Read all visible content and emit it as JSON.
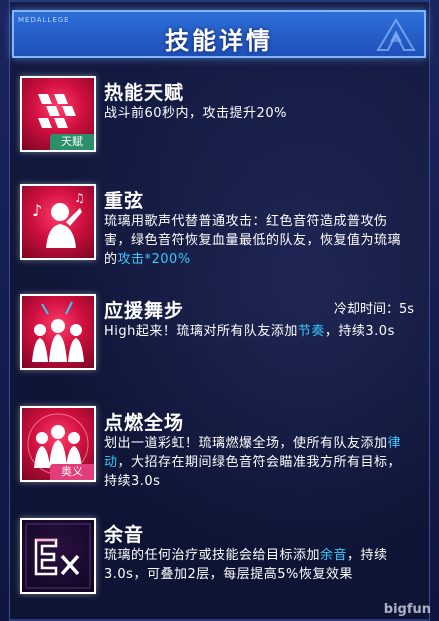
{
  "header": {
    "tag": "MEDALLEGE",
    "title": "技能详情"
  },
  "skills": [
    {
      "name": "热能天赋",
      "badge": "天赋",
      "icon": "talent-chevron-icon",
      "desc_parts": [
        {
          "text": "战斗前60秒内，攻击提升20%",
          "hl": false
        }
      ]
    },
    {
      "name": "重弦",
      "icon": "singer-note-icon",
      "desc_parts": [
        {
          "text": "琉璃用歌声代替普通攻击：红色音符造成普攻伤害，绿色音符恢复血量最低的队友，恢复值为琉璃的",
          "hl": false
        },
        {
          "text": "攻击*200%",
          "hl": true
        }
      ]
    },
    {
      "name": "应援舞步",
      "cooldown": "冷却时间：5s",
      "icon": "dancers-icon",
      "desc_parts": [
        {
          "text": "High起来！琉璃对所有队友添加",
          "hl": false
        },
        {
          "text": "节奏",
          "hl": true
        },
        {
          "text": "，持续3.0s",
          "hl": false
        }
      ]
    },
    {
      "name": "点燃全场",
      "badge": "奥义",
      "icon": "crowd-icon",
      "desc_parts": [
        {
          "text": "划出一道彩虹！琉璃燃爆全场，使所有队友添加",
          "hl": false
        },
        {
          "text": "律动",
          "hl": true
        },
        {
          "text": "，大招存在期间绿色音符会瞄准我方所有目标，持续3.0s",
          "hl": false
        }
      ]
    },
    {
      "name": "余音",
      "icon": "ex-icon",
      "desc_parts": [
        {
          "text": "琉璃的任何治疗或技能会给目标添加",
          "hl": false
        },
        {
          "text": "余音",
          "hl": true
        },
        {
          "text": "，持续3.0s，可叠加2层，每层提高5%恢复效果",
          "hl": false
        }
      ]
    }
  ],
  "watermark": "bigfun",
  "colors": {
    "header_bg": "#2d6fd8",
    "highlight": "#39c7ff",
    "icon_red": "#d0103f",
    "badge_green": "#2a8f6a",
    "badge_pink": "#e23c7a"
  }
}
